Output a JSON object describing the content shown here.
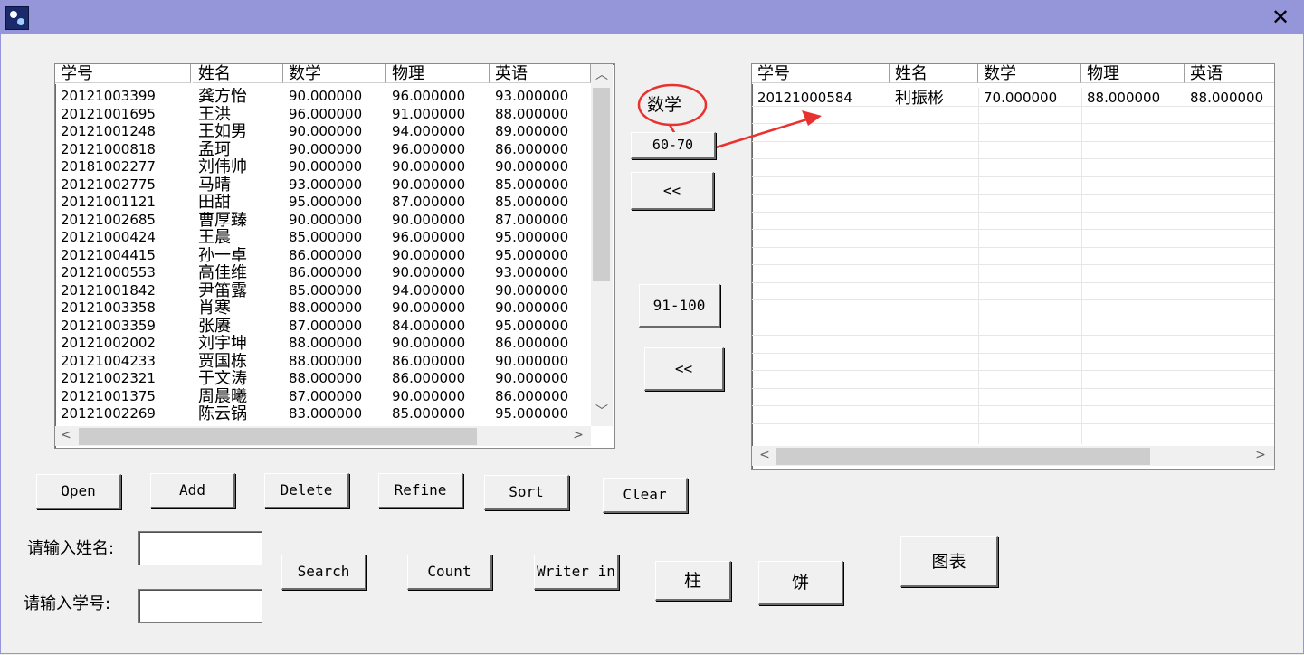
{
  "window": {
    "close_glyph": "✕",
    "icon": "app-icon"
  },
  "left_table": {
    "headers": [
      "学号",
      "姓名",
      "数学",
      "物理",
      "英语"
    ],
    "rows": [
      [
        "20121003399",
        "龚方怡",
        "90.000000",
        "96.000000",
        "93.000000"
      ],
      [
        "20121001695",
        "王洪",
        "96.000000",
        "91.000000",
        "88.000000"
      ],
      [
        "20121001248",
        "王如男",
        "90.000000",
        "94.000000",
        "89.000000"
      ],
      [
        "20121000818",
        "孟珂",
        "90.000000",
        "96.000000",
        "86.000000"
      ],
      [
        "20181002277",
        "刘伟帅",
        "90.000000",
        "90.000000",
        "90.000000"
      ],
      [
        "20121002775",
        "马晴",
        "93.000000",
        "90.000000",
        "85.000000"
      ],
      [
        "20121001121",
        "田甜",
        "95.000000",
        "87.000000",
        "85.000000"
      ],
      [
        "20121002685",
        "曹厚臻",
        "90.000000",
        "90.000000",
        "87.000000"
      ],
      [
        "20121000424",
        "王晨",
        "85.000000",
        "96.000000",
        "95.000000"
      ],
      [
        "20121004415",
        "孙一卓",
        "86.000000",
        "90.000000",
        "95.000000"
      ],
      [
        "20121000553",
        "高佳维",
        "86.000000",
        "90.000000",
        "93.000000"
      ],
      [
        "20121001842",
        "尹笛露",
        "85.000000",
        "94.000000",
        "90.000000"
      ],
      [
        "20121003358",
        "肖寒",
        "88.000000",
        "90.000000",
        "90.000000"
      ],
      [
        "20121003359",
        "张赓",
        "87.000000",
        "84.000000",
        "95.000000"
      ],
      [
        "20121002002",
        "刘宇坤",
        "88.000000",
        "90.000000",
        "86.000000"
      ],
      [
        "20121004233",
        "贾国栋",
        "88.000000",
        "86.000000",
        "90.000000"
      ],
      [
        "20121002321",
        "于文涛",
        "88.000000",
        "86.000000",
        "90.000000"
      ],
      [
        "20121001375",
        "周晨曦",
        "87.000000",
        "90.000000",
        "86.000000"
      ],
      [
        "20121002269",
        "陈云锅",
        "83.000000",
        "85.000000",
        "95.000000"
      ]
    ]
  },
  "right_table": {
    "headers": [
      "学号",
      "姓名",
      "数学",
      "物理",
      "英语"
    ],
    "rows": [
      [
        "20121000584",
        "利振彬",
        "70.000000",
        "88.000000",
        "88.000000"
      ]
    ]
  },
  "annotation": {
    "circled_text": "数学",
    "color": "#e8322f"
  },
  "buttons": {
    "range_60_70": "60-70",
    "back1": "<<",
    "range_91_100": "91-100",
    "back2": "<<",
    "open": "Open",
    "add": "Add",
    "delete": "Delete",
    "refine": "Refine",
    "sort": "Sort",
    "clear": "Clear",
    "search": "Search",
    "count": "Count",
    "writer_in": "Writer in",
    "bar": "柱",
    "pie": "饼",
    "chart": "图表"
  },
  "form": {
    "name_label": "请输入姓名:",
    "id_label": "请输入学号:",
    "name_value": "",
    "id_value": ""
  }
}
